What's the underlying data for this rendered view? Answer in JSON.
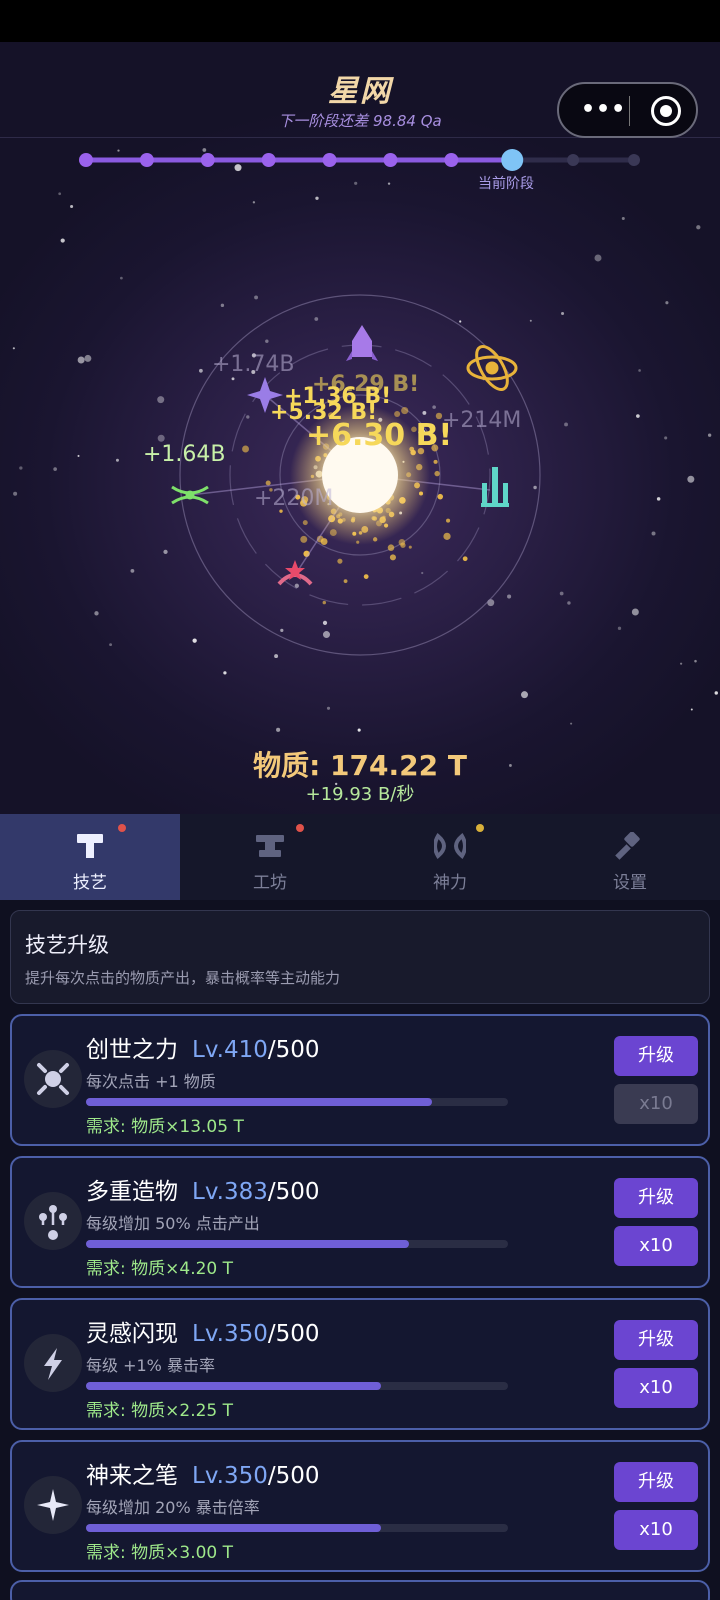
{
  "header": {
    "title": "星网",
    "subtitle": "下一阶段还差 98.84 Qa",
    "menu_glyph": "•••"
  },
  "stage_progress": {
    "total_stages": 10,
    "current_stage_index": 7,
    "current_label": "当前阶段"
  },
  "floating_texts": [
    {
      "text": "+1.74B",
      "style": "grey"
    },
    {
      "text": "+6.29 B!",
      "style": "yellow"
    },
    {
      "text": "+1.36 B!",
      "style": "yellow"
    },
    {
      "text": "+5.32 B!",
      "style": "yellow"
    },
    {
      "text": "+6.30 B!",
      "style": "yellow-lg"
    },
    {
      "text": "+214M",
      "style": "grey"
    },
    {
      "text": "+1.64B",
      "style": "green"
    },
    {
      "text": "+220M",
      "style": "grey"
    }
  ],
  "resources": {
    "matter_text": "物质: 174.22 T",
    "rate_text": "+19.93 B/秒"
  },
  "colors": {
    "accent": "#6b45d1",
    "level": "#7fa7f4",
    "requirement": "#9ee88a",
    "matter": "#f3c97a"
  },
  "tabs": [
    {
      "label": "技艺",
      "icon": "hammer-icon",
      "active": true,
      "dot_color": "#e0524a"
    },
    {
      "label": "工坊",
      "icon": "anvil-icon",
      "active": false,
      "dot_color": "#e0524a"
    },
    {
      "label": "神力",
      "icon": "infinity-icon",
      "active": false,
      "dot_color": "#d8b03a"
    },
    {
      "label": "设置",
      "icon": "wrench-icon",
      "active": false
    }
  ],
  "section": {
    "title": "技艺升级",
    "description": "提升每次点击的物质产出，暴击概率等主动能力"
  },
  "skills": [
    {
      "name": "创世之力",
      "level": "Lv.410",
      "max": "/500",
      "desc": "每次点击 +1 物质",
      "progress": 0.82,
      "requirement": "需求: 物质×13.05 T",
      "upgrade_label": "升级",
      "x10_label": "x10",
      "x10_enabled": false,
      "icon": "genesis-burst-icon"
    },
    {
      "name": "多重造物",
      "level": "Lv.383",
      "max": "/500",
      "desc": "每级增加 50% 点击产出",
      "progress": 0.766,
      "requirement": "需求: 物质×4.20 T",
      "upgrade_label": "升级",
      "x10_label": "x10",
      "x10_enabled": true,
      "icon": "multi-node-icon"
    },
    {
      "name": "灵感闪现",
      "level": "Lv.350",
      "max": "/500",
      "desc": "每级 +1% 暴击率",
      "progress": 0.7,
      "requirement": "需求: 物质×2.25 T",
      "upgrade_label": "升级",
      "x10_label": "x10",
      "x10_enabled": true,
      "icon": "lightning-icon"
    },
    {
      "name": "神来之笔",
      "level": "Lv.350",
      "max": "/500",
      "desc": "每级增加 20% 暴击倍率",
      "progress": 0.7,
      "requirement": "需求: 物质×3.00 T",
      "upgrade_label": "升级",
      "x10_label": "x10",
      "x10_enabled": true,
      "icon": "sparkle-star-icon"
    }
  ]
}
